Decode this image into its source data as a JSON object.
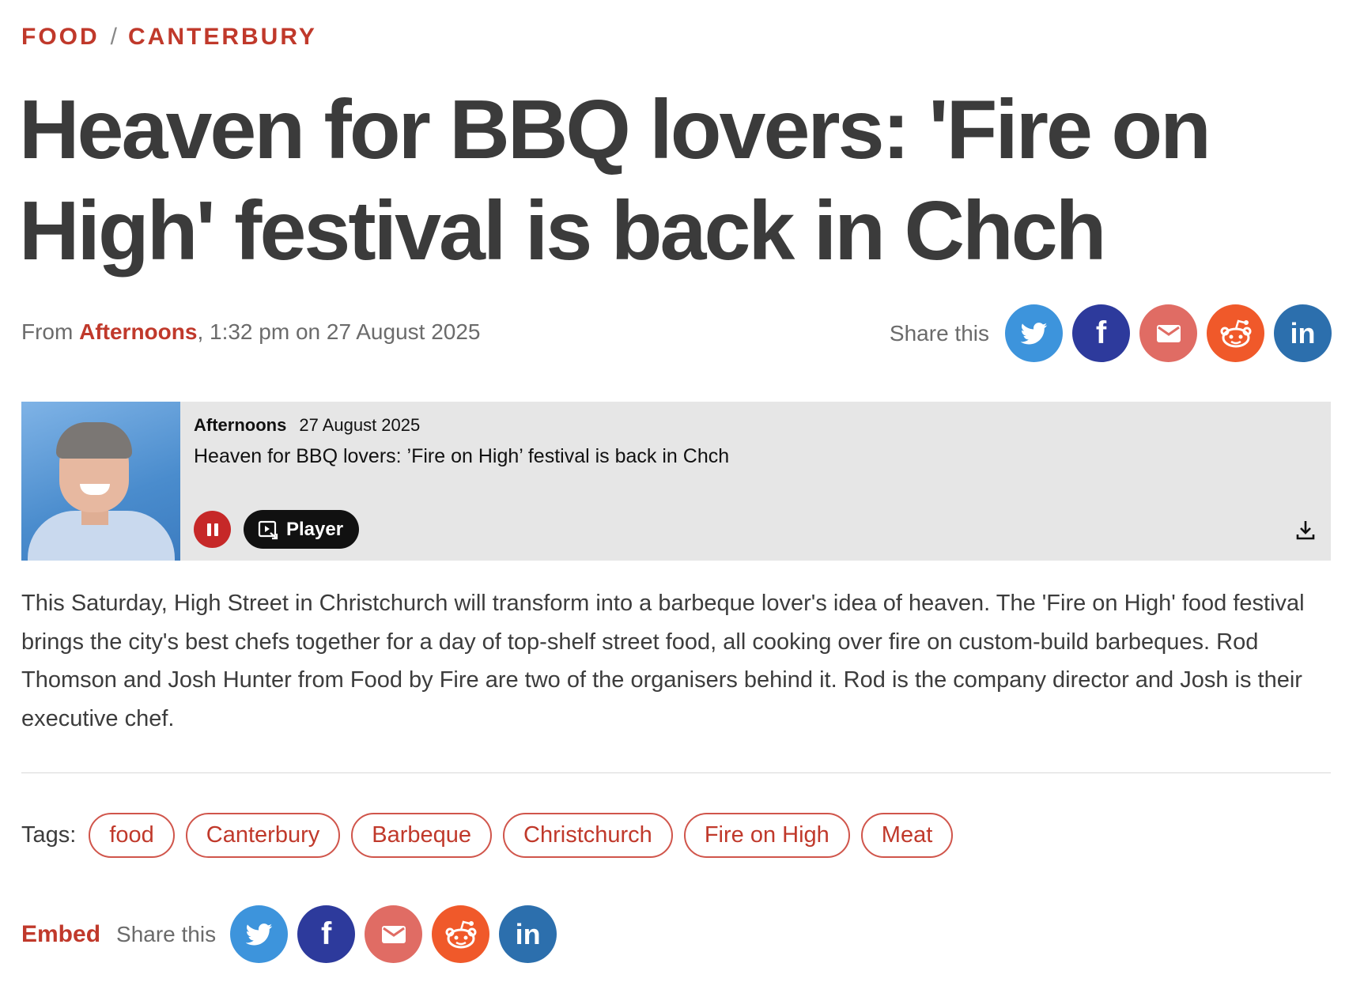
{
  "breadcrumb": {
    "category": "FOOD",
    "separator": "/",
    "region": "CANTERBURY"
  },
  "headline": "Heaven for BBQ lovers: 'Fire on High' festival is back in Chch",
  "meta": {
    "prefix": "From",
    "program": "Afternoons",
    "datetime": ", 1:32 pm on 27 August 2025"
  },
  "share": {
    "label": "Share this",
    "buttons": [
      {
        "name": "twitter",
        "icon": "twitter-bird-icon",
        "color": "#3d94dc"
      },
      {
        "name": "facebook",
        "icon": "facebook-f-icon",
        "color": "#2d3a9c"
      },
      {
        "name": "email",
        "icon": "envelope-icon",
        "color": "#e06c64"
      },
      {
        "name": "reddit",
        "icon": "reddit-alien-icon",
        "color": "#f0592a"
      },
      {
        "name": "linkedin",
        "icon": "linkedin-in-icon",
        "color": "#2c6fad"
      }
    ],
    "facebook_glyph": "f",
    "linkedin_glyph": "in"
  },
  "player_card": {
    "program": "Afternoons",
    "date": "27 August 2025",
    "title": "Heaven for BBQ lovers: ’Fire on High’ festival is back in Chch",
    "player_label": "Player",
    "state": "playing"
  },
  "summary": "This Saturday, High Street in Christchurch will transform into a barbeque lover's idea of heaven. The 'Fire on High' food festival brings the city's best chefs together for a day of top-shelf street food, all cooking over fire on custom-build barbeques. Rod Thomson and Josh Hunter from Food by Fire are two of the organisers behind it. Rod is the company director and Josh is their executive chef.",
  "tags": {
    "label": "Tags:",
    "items": [
      "food",
      "Canterbury",
      "Barbeque",
      "Christchurch",
      "Fire on High",
      "Meat"
    ]
  },
  "footer": {
    "embed_label": "Embed",
    "share_label": "Share this"
  },
  "colors": {
    "accent": "#c0392b",
    "headline": "#3b3b3b",
    "card_bg": "#e6e6e6"
  }
}
